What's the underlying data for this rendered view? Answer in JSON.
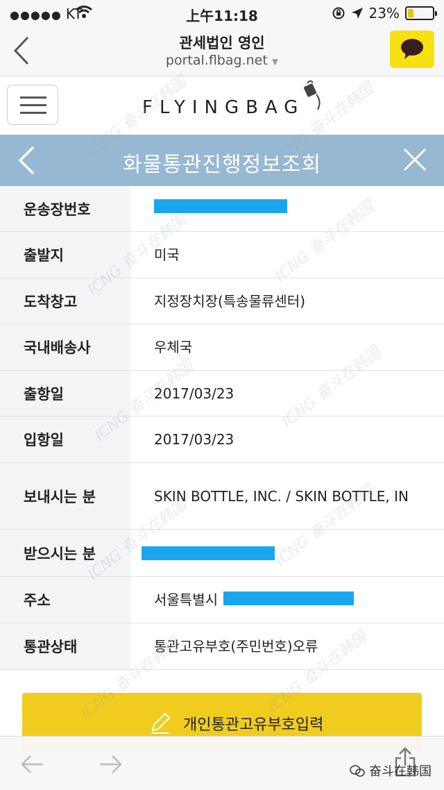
{
  "status_bar": {
    "signal_dots": "●●●●●",
    "carrier": "KT",
    "time": "上午11:18",
    "battery": "23%",
    "battery_level": 0.23
  },
  "nav_header": {
    "title": "관세법인 영인",
    "url": "portal.flbag.net"
  },
  "logo_bar": {
    "logo_text": "FLYINGBAG"
  },
  "title_bar": {
    "title": "화물통관진행정보조회"
  },
  "rows": [
    {
      "label": "운송장번호",
      "value": "",
      "redacted": true
    },
    {
      "label": "출발지",
      "value": "미국"
    },
    {
      "label": "도착창고",
      "value": "지정장치장(특송물류센터)"
    },
    {
      "label": "국내배송사",
      "value": "우체국"
    },
    {
      "label": "출항일",
      "value": "2017/03/23"
    },
    {
      "label": "입항일",
      "value": "2017/03/23"
    },
    {
      "label": "보내시는 분",
      "value": "SKIN BOTTLE, INC. / SKIN BOTTLE, IN"
    },
    {
      "label": "받으시는 분",
      "value": "",
      "redacted": true
    },
    {
      "label": "주소",
      "value": "서울특별시",
      "redacted": true
    },
    {
      "label": "통관상태",
      "value": "통관고유부호(주민번호)오류"
    }
  ],
  "apply_button": {
    "label": "개인통관고유부호입력"
  },
  "toolbar": {
    "corner_text": "奋斗在韩国"
  },
  "colors": {
    "title_bar_bg": "#97b8d2",
    "kakao_yellow": "#f7e012",
    "button_yellow": "#f0cc1e",
    "redaction_blue": "#1aa6ee"
  }
}
